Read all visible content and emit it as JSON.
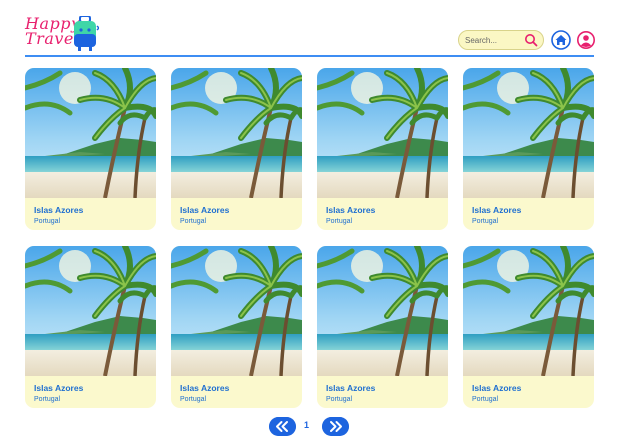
{
  "brand": {
    "line1": "Happy",
    "line2": "Travel",
    "primary_color": "#e8206e",
    "accent_color": "#1d64df"
  },
  "search": {
    "placeholder": "Search...",
    "icon": "search-icon"
  },
  "nav": {
    "home_icon": "home-icon",
    "profile_icon": "user-icon"
  },
  "cards": [
    {
      "title": "Islas Azores",
      "subtitle": "Portugal"
    },
    {
      "title": "Islas Azores",
      "subtitle": "Portugal"
    },
    {
      "title": "Islas Azores",
      "subtitle": "Portugal"
    },
    {
      "title": "Islas Azores",
      "subtitle": "Portugal"
    },
    {
      "title": "Islas Azores",
      "subtitle": "Portugal"
    },
    {
      "title": "Islas Azores",
      "subtitle": "Portugal"
    },
    {
      "title": "Islas Azores",
      "subtitle": "Portugal"
    },
    {
      "title": "Islas Azores",
      "subtitle": "Portugal"
    }
  ],
  "pagination": {
    "current_page": "1",
    "prev_icon": "chevron-double-left-icon",
    "next_icon": "chevron-double-right-icon"
  }
}
